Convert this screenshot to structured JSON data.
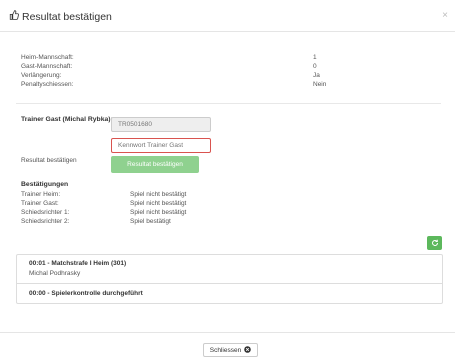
{
  "modal": {
    "title": "Resultat bestätigen",
    "close_symbol": "×"
  },
  "summary": [
    {
      "label": "Heim-Mannschaft:",
      "value": "1"
    },
    {
      "label": "Gast-Mannschaft:",
      "value": "0"
    },
    {
      "label": "Verlängerung:",
      "value": "Ja"
    },
    {
      "label": "Penaltyschiessen:",
      "value": "Nein"
    }
  ],
  "trainer": {
    "label": "Trainer Gast (Michal Rybka):",
    "id_value": "TR0501680",
    "password_placeholder": "Kennwort Trainer Gast",
    "confirm_label": "Resultat bestätigen",
    "confirm_button": "Resultat bestätigen"
  },
  "bestaetigungen": {
    "title": "Bestätigungen",
    "rows": [
      {
        "label": "Trainer Heim:",
        "status": "Spiel nicht bestätigt"
      },
      {
        "label": "Trainer Gast:",
        "status": "Spiel nicht bestätigt"
      },
      {
        "label": "Schiedsrichter 1:",
        "status": "Spiel nicht bestätigt"
      },
      {
        "label": "Schiedsrichter 2:",
        "status": "Spiel bestätigt"
      }
    ]
  },
  "events": [
    {
      "title": "00:01 - Matchstrafe I Heim (301)",
      "subtitle": "Michal Podhrasky"
    },
    {
      "title": "00:00 - Spielerkontrolle durchgeführt",
      "subtitle": ""
    }
  ],
  "footer": {
    "close_label": "Schliessen"
  },
  "icons": {
    "title_icon": "thumbs-up-icon",
    "refresh_icon": "refresh-icon",
    "close_btn_icon": "times-circle-icon"
  },
  "colors": {
    "accent_green": "#5cb85c",
    "confirm_button_green": "#8fd18f",
    "invalid_border": "#d9534f"
  }
}
